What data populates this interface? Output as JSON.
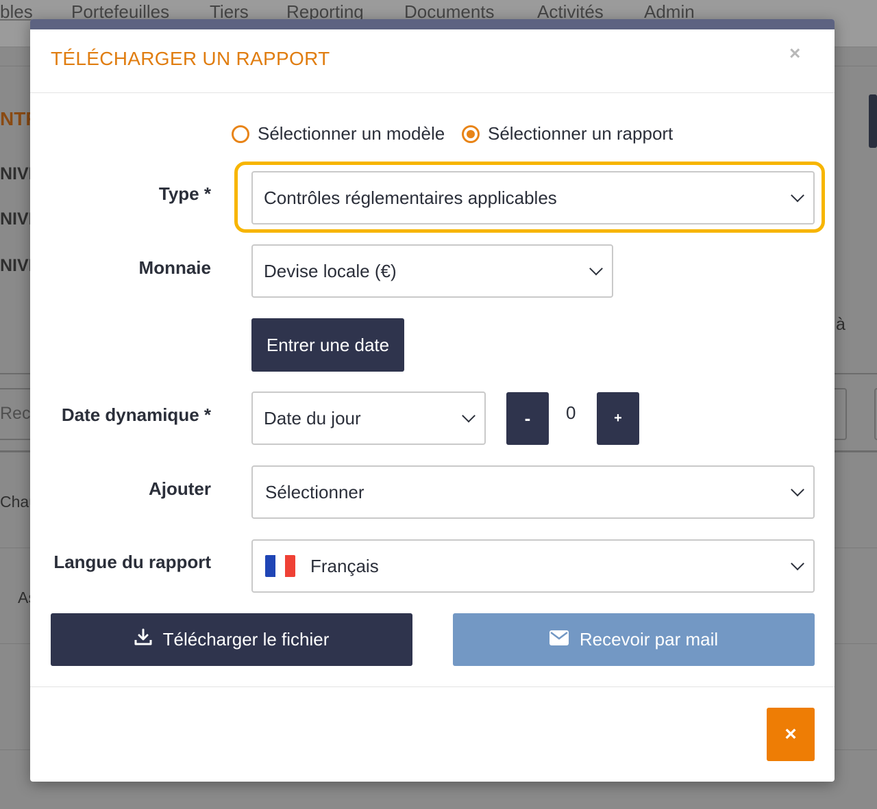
{
  "background": {
    "nav_items": [
      "bles",
      "Portefeuilles",
      "Tiers",
      "Reporting",
      "Documents",
      "Activités",
      "Admin"
    ],
    "fragments": [
      "NTR",
      "NIVE",
      "NIVE",
      "NIVE",
      "à",
      "Rec",
      "Chau",
      "As"
    ]
  },
  "modal": {
    "title": "TÉLÉCHARGER UN RAPPORT",
    "close_glyph": "×",
    "radio_options": [
      {
        "label": "Sélectionner un modèle",
        "checked": false
      },
      {
        "label": "Sélectionner un rapport",
        "checked": true
      }
    ],
    "type": {
      "label": "Type *",
      "value": "Contrôles réglementaires applicables"
    },
    "currency": {
      "label": "Monnaie",
      "value": "Devise locale (€)"
    },
    "enter_date_button": "Entrer une date",
    "dynamic_date": {
      "label": "Date dynamique *",
      "value": "Date du jour",
      "minus": "-",
      "plus": "+",
      "offset": "0"
    },
    "add": {
      "label": "Ajouter",
      "value": "Sélectionner"
    },
    "language": {
      "label": "Langue du rapport",
      "value": "Français",
      "flag_icon": "flag-fr-icon"
    },
    "download_button": "Télécharger le fichier",
    "mail_button": "Recevoir par mail",
    "footer_close_glyph": "×"
  },
  "colors": {
    "accent_orange": "#e07d10",
    "highlight": "#f7b500",
    "dark_button": "#2f344d",
    "mail_button": "#7398c4"
  }
}
